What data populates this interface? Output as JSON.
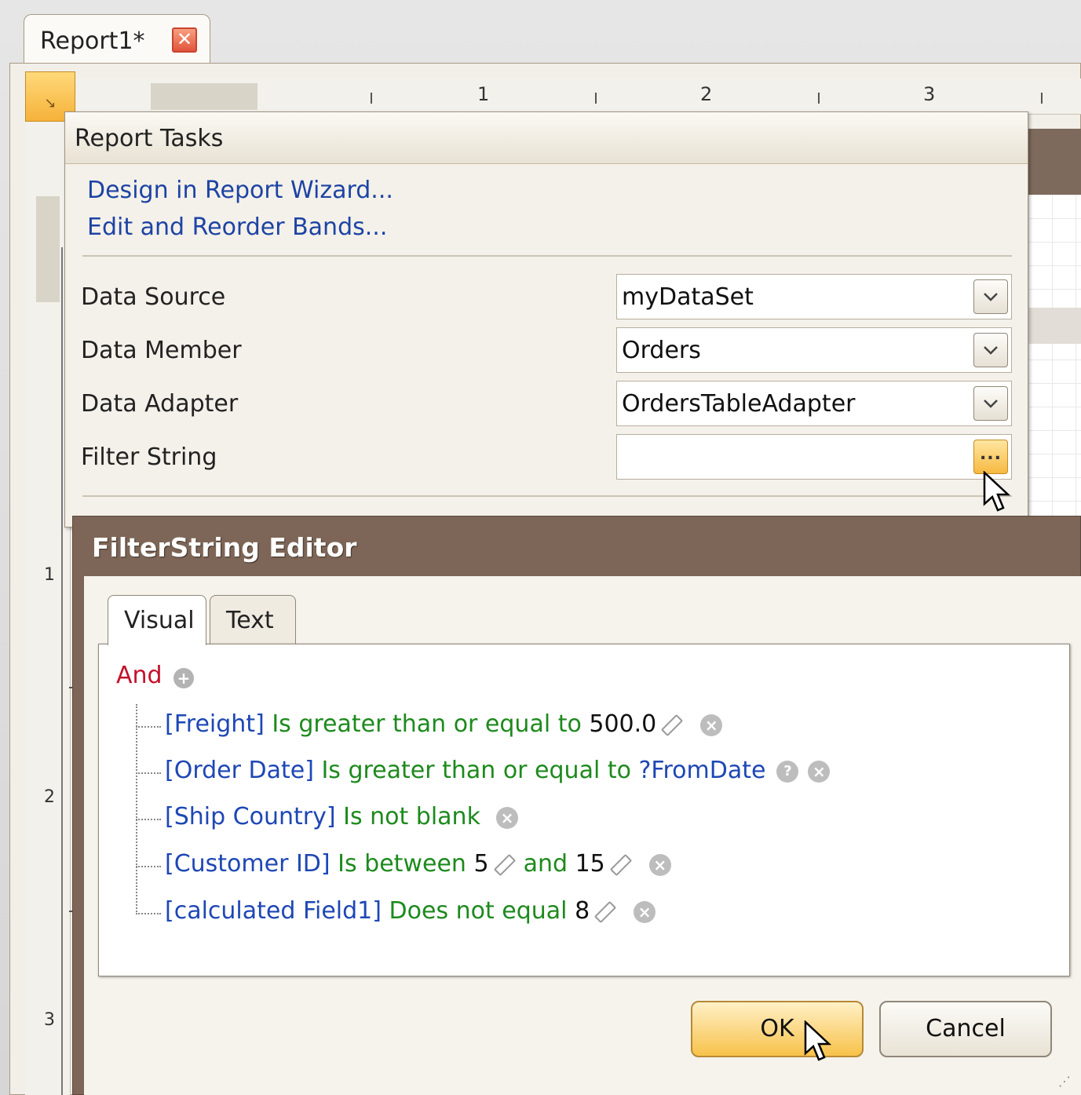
{
  "document_tab": {
    "label": "Report1*",
    "close_glyph": "✕"
  },
  "rulers": {
    "top_numbers": [
      "1",
      "2",
      "3"
    ],
    "left_numbers": [
      "1",
      "2",
      "3"
    ]
  },
  "report_tasks": {
    "title": "Report Tasks",
    "links": [
      "Design in Report Wizard...",
      "Edit and Reorder Bands..."
    ],
    "properties": [
      {
        "label": "Data Source",
        "value": "myDataSet",
        "button": "dropdown"
      },
      {
        "label": "Data Member",
        "value": "Orders",
        "button": "dropdown"
      },
      {
        "label": "Data Adapter",
        "value": "OrdersTableAdapter",
        "button": "dropdown"
      },
      {
        "label": "Filter String",
        "value": "",
        "button": "ellipsis"
      }
    ],
    "ellipsis_glyph": "..."
  },
  "filter_editor": {
    "title": "FilterString Editor",
    "tabs": [
      {
        "label": "Visual",
        "active": true
      },
      {
        "label": "Text",
        "active": false
      }
    ],
    "group_operator": "And",
    "conditions": [
      {
        "field": "[Freight]",
        "operator": "Is greater than or equal to",
        "value": "500.0"
      },
      {
        "field": "[Order Date]",
        "operator": "Is greater than or equal to",
        "parameter": "?FromDate"
      },
      {
        "field": "[Ship Country]",
        "operator": "Is not blank"
      },
      {
        "field": "[Customer ID]",
        "operator": "Is between",
        "value": "5",
        "conjunction": "and",
        "value2": "15"
      },
      {
        "field": "[calculated Field1]",
        "operator": "Does not equal",
        "value": "8"
      }
    ],
    "buttons": {
      "ok": "OK",
      "cancel": "Cancel"
    }
  },
  "colors": {
    "link": "#1d44a4",
    "field": "#1e47b5",
    "operator": "#1d8a1d",
    "group": "#c4122b",
    "dialog_title_bar": "#7d6657",
    "ok_button": "#f7c24a"
  }
}
